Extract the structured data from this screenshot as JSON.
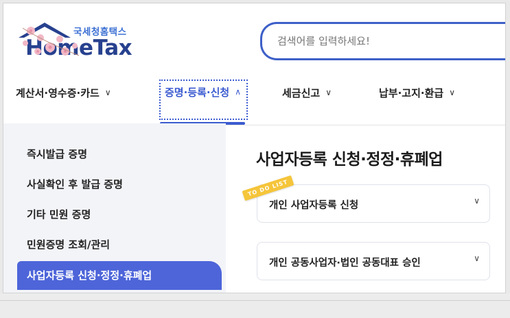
{
  "header": {
    "logo_sub": "국세청홈택스",
    "logo_main": "HomeTax",
    "search_placeholder": "검색어를 입력하세요!"
  },
  "nav": {
    "items": [
      {
        "label": "계산서·영수증·카드",
        "chevron": "∨"
      },
      {
        "label": "증명·등록·신청",
        "chevron": "∧",
        "active": true
      },
      {
        "label": "세금신고",
        "chevron": "∨"
      },
      {
        "label": "납부·고지·환급",
        "chevron": "∨"
      }
    ]
  },
  "sidebar": {
    "items": [
      {
        "label": "즉시발급 증명"
      },
      {
        "label": "사실확인 후 발급 증명"
      },
      {
        "label": "기타 민원 증명"
      },
      {
        "label": "민원증명 조회/관리"
      },
      {
        "label": "사업자등록 신청·정정·휴폐업",
        "active": true
      }
    ]
  },
  "main": {
    "title": "사업자등록 신청·정정·휴폐업",
    "sticker": "TO DO LIST",
    "cards": [
      {
        "label": "개인 사업자등록 신청"
      },
      {
        "label": "개인 공동사업자·법인 공동대표 승인"
      }
    ]
  },
  "colors": {
    "accent": "#3b5bd0",
    "sidebar_active": "#4d65d9",
    "sidebar_bg": "#f3f4f8",
    "logo_navy": "#27418f",
    "sticker": "#f5c53a"
  }
}
